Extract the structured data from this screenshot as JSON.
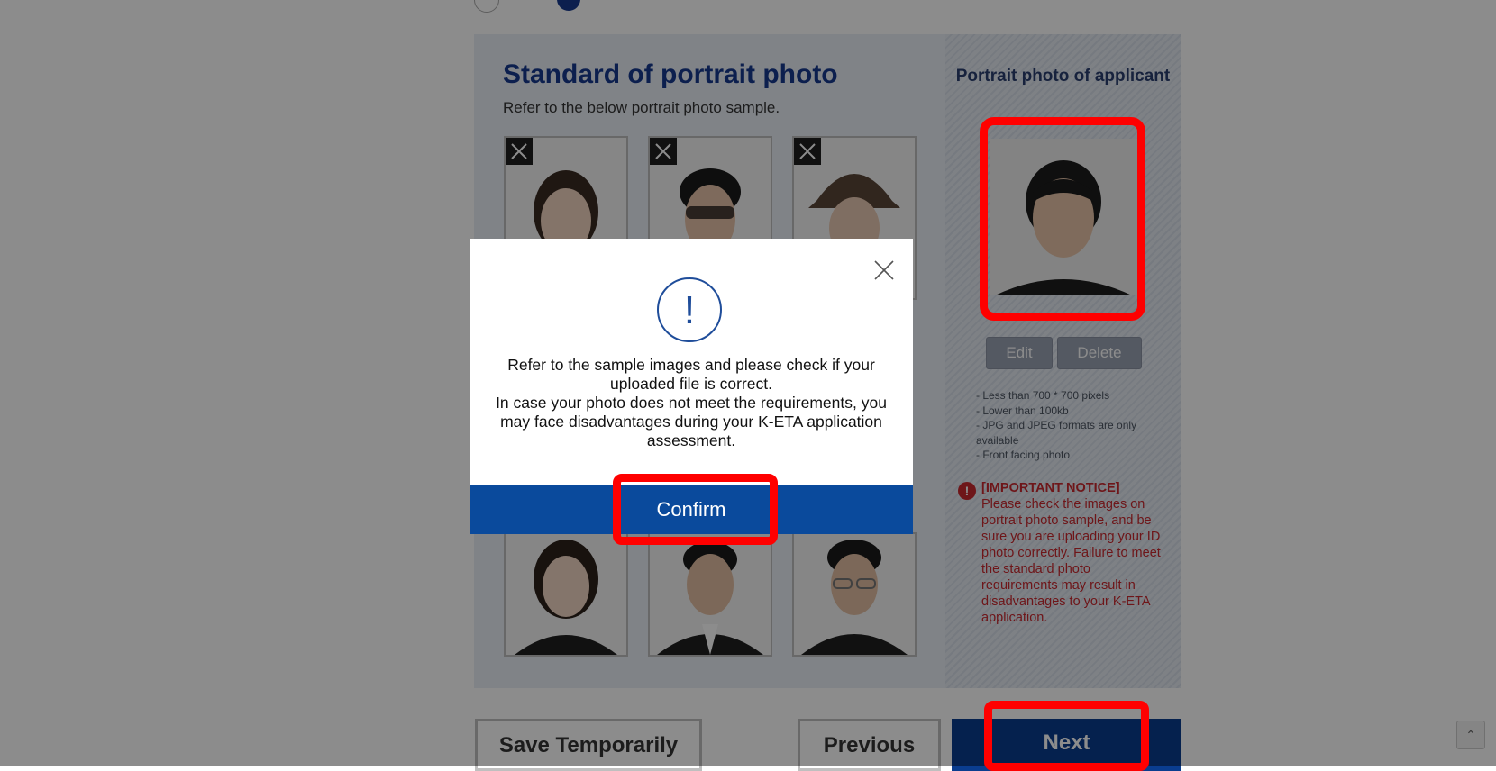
{
  "page": {
    "title": "Standard of portrait photo",
    "subtitle": "Refer to the below portrait photo sample."
  },
  "applicant_panel": {
    "title": "Portrait photo of applicant",
    "edit_label": "Edit",
    "delete_label": "Delete",
    "requirements": [
      "- Less than 700 * 700 pixels",
      "- Lower than 100kb",
      "- JPG and JPEG formats are only available",
      "- Front facing photo"
    ],
    "notice_title": "[IMPORTANT NOTICE]",
    "notice_text": "Please check the images on portrait photo sample, and be sure you are uploading your ID photo correctly. Failure to meet the standard photo requirements may result in disadvantages to your K-ETA application."
  },
  "bottom_buttons": {
    "save_label": "Save Temporarily",
    "previous_label": "Previous",
    "next_label": "Next"
  },
  "modal": {
    "icon": "!",
    "message_line1": "Refer to the sample images and please check if your uploaded file is correct.",
    "message_line2": "In case your photo does not meet the requirements, you may face disadvantages during your K-ETA application assessment.",
    "confirm_label": "Confirm"
  },
  "colors": {
    "brand_blue": "#0a3d8f",
    "modal_footer": "#0a4a9c",
    "notice_red": "#c8282e",
    "highlight_red": "#ff0000"
  },
  "icons": {
    "bad_sample_mark": "close-icon",
    "modal_alert": "exclamation-icon",
    "modal_close": "close-icon",
    "scroll_top": "chevron-up-icon"
  }
}
